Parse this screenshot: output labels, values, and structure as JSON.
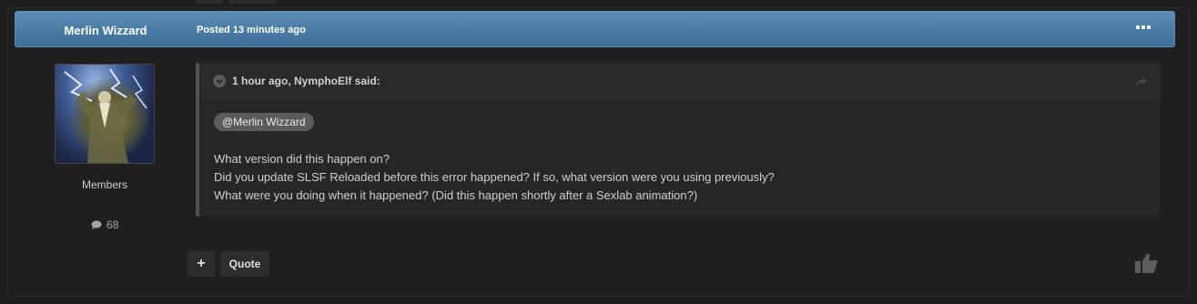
{
  "post": {
    "author_name": "Merlin Wizzard",
    "posted": "Posted 13 minutes ago",
    "member_group": "Members",
    "post_count": "68"
  },
  "quote": {
    "citation": "1 hour ago, NymphoElf said:",
    "mention": "@Merlin Wizzard",
    "lines": [
      "What version did this happen on?",
      "Did you update SLSF Reloaded before this error happened? If so, what version were you using previously?",
      "What were you doing when it happened? (Did this happen shortly after a Sexlab animation?)"
    ]
  },
  "actions": {
    "multiquote_label": "+",
    "quote_label": "Quote"
  },
  "icons": {
    "more": "ellipsis-icon",
    "toggle": "chevron-down-icon",
    "share": "share-arrow-icon",
    "comment": "comment-icon",
    "like": "thumbs-up-icon"
  },
  "colors": {
    "header_bg": "#4d7fa8",
    "page_bg": "#1e1e1e",
    "quote_bg": "#262626"
  }
}
